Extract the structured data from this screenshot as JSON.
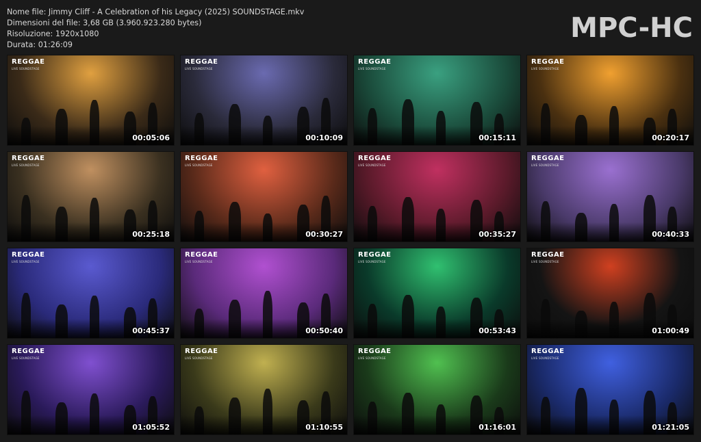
{
  "info": {
    "filename": "Nome file: Jimmy Cliff - A Celebration of his Legacy (2025) SOUNDSTAGE.mkv",
    "filesize": "Dimensioni del file: 3,68 GB (3.960.923.280 bytes)",
    "resolution": "Risoluzione: 1920x1080",
    "duration": "Durata: 01:26:09"
  },
  "brand": "MPC-HC",
  "logo": {
    "main": "REGGAE",
    "sub": "LIVE SOUNDSTAGE"
  },
  "thumbnails": [
    {
      "time": "00:05:06",
      "bg": "#3a2a18",
      "glow": "#e0a040"
    },
    {
      "time": "00:10:09",
      "bg": "#2a2a3a",
      "glow": "#6a6ab0"
    },
    {
      "time": "00:15:11",
      "bg": "#1a4a3a",
      "glow": "#3aa080"
    },
    {
      "time": "00:20:17",
      "bg": "#4a3010",
      "glow": "#f0a030"
    },
    {
      "time": "00:25:18",
      "bg": "#3a3020",
      "glow": "#c09060"
    },
    {
      "time": "00:30:27",
      "bg": "#5a2a1a",
      "glow": "#e06040"
    },
    {
      "time": "00:35:27",
      "bg": "#5a1a2a",
      "glow": "#c03060"
    },
    {
      "time": "00:40:33",
      "bg": "#4a3a6a",
      "glow": "#9a70d0"
    },
    {
      "time": "00:45:37",
      "bg": "#2a2a7a",
      "glow": "#5a5ad0"
    },
    {
      "time": "00:50:40",
      "bg": "#5a2a7a",
      "glow": "#b050d0"
    },
    {
      "time": "00:53:43",
      "bg": "#0a3a2a",
      "glow": "#30c070"
    },
    {
      "time": "01:00:49",
      "bg": "#141414",
      "glow": "#d04020"
    },
    {
      "time": "01:05:52",
      "bg": "#2a1a5a",
      "glow": "#8050d0"
    },
    {
      "time": "01:10:55",
      "bg": "#3a3a1a",
      "glow": "#c0b050"
    },
    {
      "time": "01:16:01",
      "bg": "#1a3a1a",
      "glow": "#50c050"
    },
    {
      "time": "01:21:05",
      "bg": "#1a2a6a",
      "glow": "#4060e0"
    }
  ]
}
